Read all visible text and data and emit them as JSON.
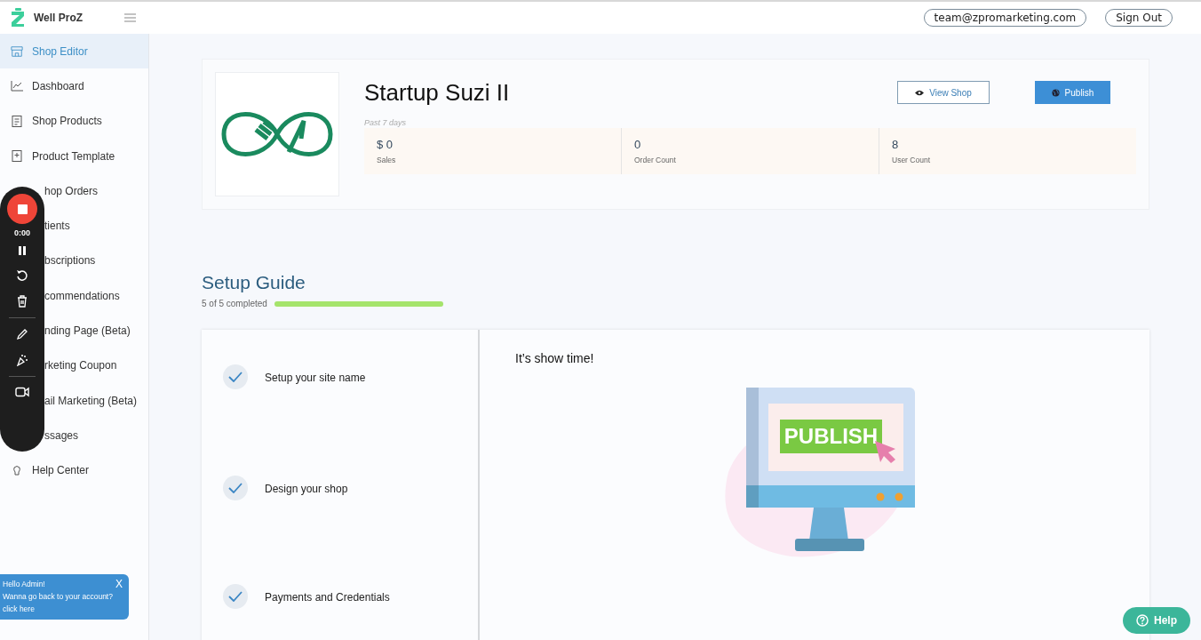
{
  "header": {
    "brand": "Well ProZ",
    "email": "team@zpromarketing.com",
    "sign_out": "Sign Out"
  },
  "sidebar": {
    "items": [
      {
        "label": "Shop Editor",
        "selected": true
      },
      {
        "label": "Dashboard",
        "selected": false
      },
      {
        "label": "Shop Products",
        "selected": false
      },
      {
        "label": "Product Template",
        "selected": false
      },
      {
        "label": "hop Orders",
        "selected": false
      },
      {
        "label": "tients",
        "selected": false
      },
      {
        "label": "bscriptions",
        "selected": false
      },
      {
        "label": "commendations",
        "selected": false
      },
      {
        "label": "nding Page (Beta)",
        "selected": false
      },
      {
        "label": "rketing Coupon",
        "selected": false
      },
      {
        "label": "ail Marketing (Beta)",
        "selected": false
      },
      {
        "label": "ssages",
        "selected": false
      },
      {
        "label": "Help Center",
        "selected": false
      }
    ]
  },
  "admin_banner": {
    "greeting": "Hello Admin!",
    "message": "Wanna go back to your account? click here",
    "close": "X"
  },
  "recorder": {
    "time": "0:00"
  },
  "shop": {
    "name": "Startup Suzi II",
    "view_button": "View Shop",
    "publish_button": "Publish",
    "period": "Past 7 days",
    "stats": [
      {
        "value": "$ 0",
        "label": "Sales"
      },
      {
        "value": "0",
        "label": "Order Count"
      },
      {
        "value": "8",
        "label": "User Count"
      }
    ]
  },
  "setup_guide": {
    "title": "Setup Guide",
    "progress_text": "5 of 5 completed",
    "level": 1.0,
    "steps": [
      {
        "label": "Setup your site name",
        "checked": true
      },
      {
        "label": "Design your shop",
        "checked": true
      },
      {
        "label": "Payments and Credentials",
        "checked": true
      }
    ],
    "panel_title": "It’s show time!",
    "illustration_label": "PUBLISH"
  },
  "help_button": "Help"
}
